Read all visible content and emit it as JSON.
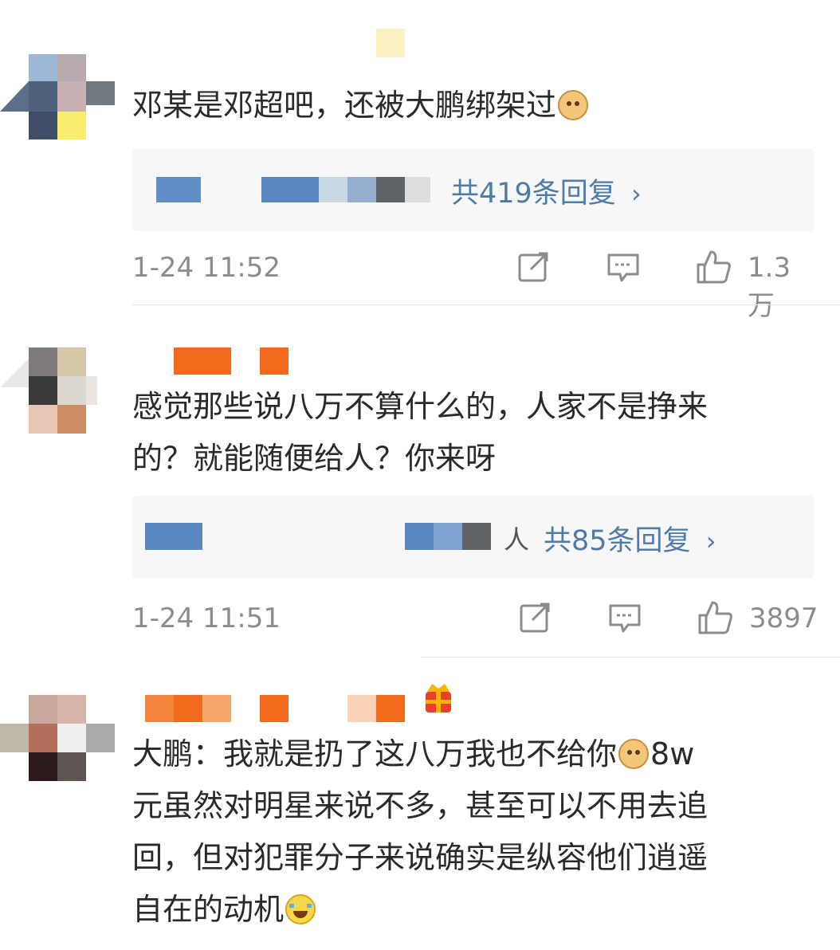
{
  "comments": [
    {
      "content": "邓某是邓超吧，还被大鹏绑架过",
      "emoji_end": "doge",
      "reply_count_text": "共419条回复",
      "time": "1-24 11:52",
      "likes": "1.3万"
    },
    {
      "content_line1": "感觉那些说八万不算什么的，人家不是挣来",
      "content_line2": "的？就能随便给人？你来呀",
      "reply_person_suffix": "人",
      "reply_count_text": "共85条回复",
      "time": "1-24 11:51",
      "likes": "3897"
    },
    {
      "content_line1": "大鹏：我就是扔了这八万我也不给你",
      "content_line1_tail": "8w",
      "content_line2": "元虽然对明星来说不多，甚至可以不用去追",
      "content_line3": "回，但对犯罪分子来说确实是纵容他们逍遥",
      "content_line4": "自在的动机"
    }
  ],
  "colors": {
    "link": "#4d7ca8",
    "meta_text": "#8c8c8c",
    "username_redacted": "#f26b1d",
    "reply_background": "#f7f7f7"
  },
  "icons": [
    "share-icon",
    "comment-icon",
    "like-icon",
    "doge-emoji",
    "laugh-cry-emoji",
    "fan-badge-icon",
    "chevron-right-icon"
  ]
}
